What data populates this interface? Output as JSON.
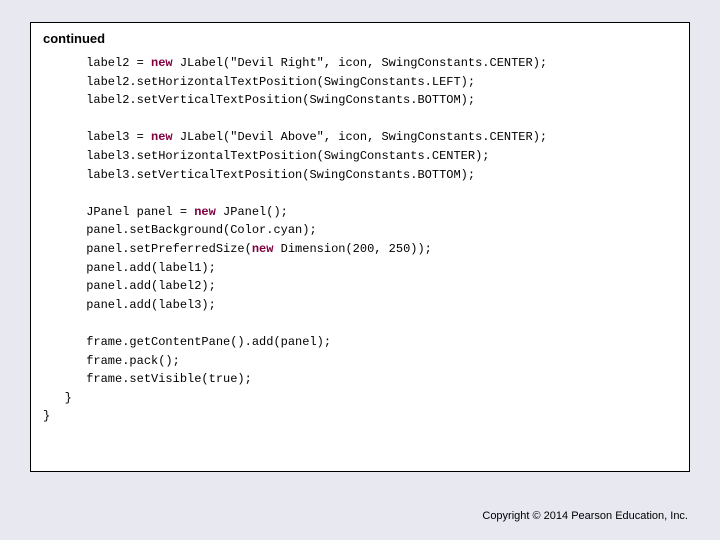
{
  "heading": "continued",
  "code": {
    "l1a": "      label2 = ",
    "kw_new1": "new",
    "l1b": " JLabel(\"Devil Right\", icon, SwingConstants.CENTER);",
    "l2": "      label2.setHorizontalTextPosition(SwingConstants.LEFT);",
    "l3": "      label2.setVerticalTextPosition(SwingConstants.BOTTOM);",
    "blank1": "",
    "l4a": "      label3 = ",
    "kw_new2": "new",
    "l4b": " JLabel(\"Devil Above\", icon, SwingConstants.CENTER);",
    "l5": "      label3.setHorizontalTextPosition(SwingConstants.CENTER);",
    "l6": "      label3.setVerticalTextPosition(SwingConstants.BOTTOM);",
    "blank2": "",
    "l7a": "      JPanel panel = ",
    "kw_new3": "new",
    "l7b": " JPanel();",
    "l8": "      panel.setBackground(Color.cyan);",
    "l9a": "      panel.setPreferredSize(",
    "kw_new4": "new",
    "l9b": " Dimension(200, 250));",
    "l10": "      panel.add(label1);",
    "l11": "      panel.add(label2);",
    "l12": "      panel.add(label3);",
    "blank3": "",
    "l13": "      frame.getContentPane().add(panel);",
    "l14": "      frame.pack();",
    "l15": "      frame.setVisible(true);",
    "l16": "   }",
    "l17": "}"
  },
  "copyright": "Copyright © 2014 Pearson Education, Inc."
}
